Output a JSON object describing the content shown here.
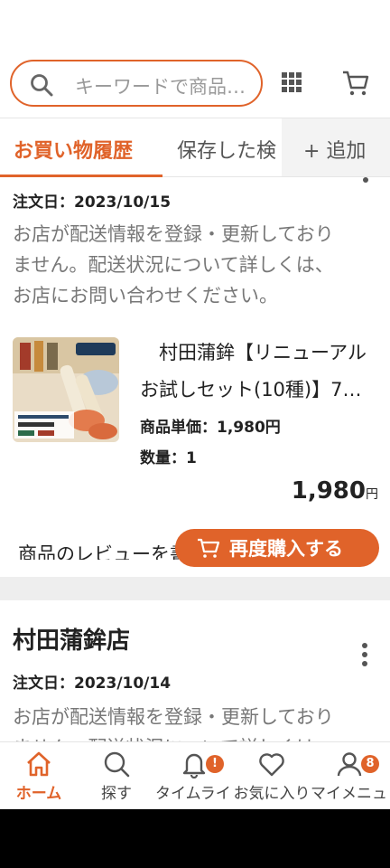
{
  "header": {
    "search_placeholder": "キーワードで商品…"
  },
  "tabs": {
    "active": "お買い物履歴",
    "second": "保存した検",
    "add": "+ 追加"
  },
  "orders": [
    {
      "date": "注文日：2023/10/15",
      "notice_lines": [
        "お店が配送情報を登録・更新しており",
        "ません。配送状況について詳しくは、",
        "お店にお問い合わせください。"
      ],
      "product_title_line1": "　村田蒲鉾【リニューアル",
      "product_title_line2": "お試しセット(10種)】7…",
      "unit_price": "商品単価：1,980円",
      "quantity": "数量：1",
      "total_value": "1,980",
      "total_unit": "円",
      "review_link": "商品のレビューを書く",
      "rebuy_label": "再度購入する"
    },
    {
      "shop_name": "村田蒲鉾店",
      "date": "注文日：2023/10/14",
      "notice_lines": [
        "お店が配送情報を登録・更新しており",
        "ません。配送状況について詳しくは、"
      ]
    }
  ],
  "bottom_nav": [
    {
      "label": "ホーム",
      "icon": "home-icon"
    },
    {
      "label": "探す",
      "icon": "search-icon"
    },
    {
      "label": "タイムライン",
      "icon": "bell-icon",
      "badge": "!"
    },
    {
      "label": "お気に入り",
      "icon": "heart-icon"
    },
    {
      "label": "マイメニュー",
      "icon": "user-icon",
      "badge": "8"
    }
  ],
  "colors": {
    "accent": "#e0632a"
  }
}
